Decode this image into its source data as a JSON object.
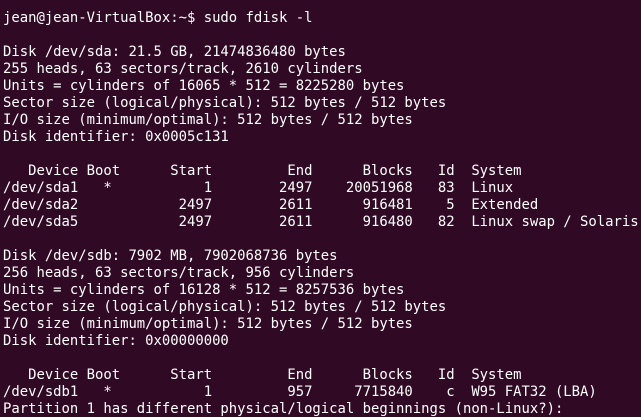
{
  "window": {
    "bg_color": "#300a24",
    "text_color": "#ffffff"
  },
  "terminal": {
    "lines": [
      "jean@jean-VirtualBox:~$ sudo fdisk -l",
      "",
      "Disk /dev/sda: 21.5 GB, 21474836480 bytes",
      "255 heads, 63 sectors/track, 2610 cylinders",
      "Units = cylinders of 16065 * 512 = 8225280 bytes",
      "Sector size (logical/physical): 512 bytes / 512 bytes",
      "I/O size (minimum/optimal): 512 bytes / 512 bytes",
      "Disk identifier: 0x0005c131",
      "",
      "   Device Boot      Start         End      Blocks   Id  System",
      "/dev/sda1   *           1        2497    20051968   83  Linux",
      "/dev/sda2            2497        2611      916481    5  Extended",
      "/dev/sda5            2497        2611      916480   82  Linux swap / Solaris",
      "",
      "Disk /dev/sdb: 7902 MB, 7902068736 bytes",
      "256 heads, 63 sectors/track, 956 cylinders",
      "Units = cylinders of 16128 * 512 = 8257536 bytes",
      "Sector size (logical/physical): 512 bytes / 512 bytes",
      "I/O size (minimum/optimal): 512 bytes / 512 bytes",
      "Disk identifier: 0x00000000",
      "",
      "   Device Boot      Start         End      Blocks   Id  System",
      "/dev/sdb1   *           1         957     7715840    c  W95 FAT32 (LBA)",
      "Partition 1 has different physical/logical beginnings (non-Linux?):"
    ]
  }
}
